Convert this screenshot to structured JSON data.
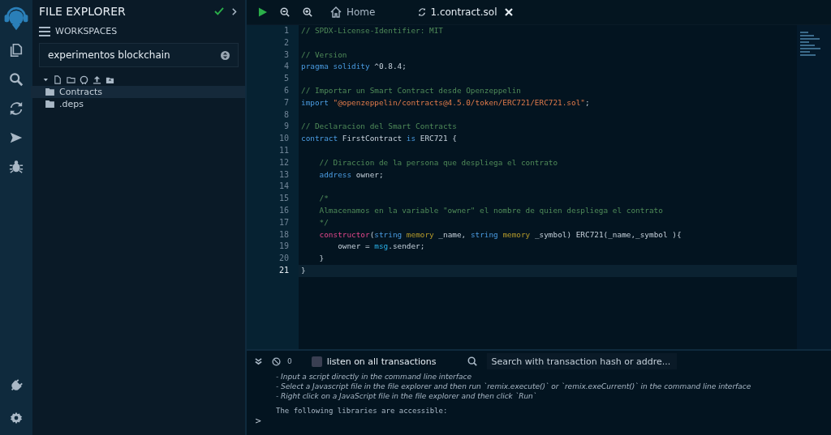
{
  "icon_bar": {
    "items": [
      {
        "kind": "files"
      },
      {
        "kind": "search"
      },
      {
        "kind": "compiler"
      },
      {
        "kind": "deploy"
      },
      {
        "kind": "debug"
      }
    ],
    "bottom": [
      {
        "kind": "plugin"
      },
      {
        "kind": "settings"
      }
    ]
  },
  "side_panel": {
    "title": "FILE EXPLORER",
    "workspaces_label": "WORKSPACES",
    "workspace": "experimentos blockchain",
    "tree": [
      {
        "label": "Contracts",
        "selected": true
      },
      {
        "label": ".deps",
        "selected": false
      }
    ]
  },
  "editor": {
    "tabs": [
      {
        "label": "Home",
        "kind": "home",
        "selected": false
      },
      {
        "label": "1.contract.sol",
        "kind": "file",
        "selected": true
      }
    ],
    "lines": [
      {
        "number": "1",
        "current": false,
        "tokens": [
          {
            "kind": "comment",
            "text": "// SPDX-License-Identifier: MIT"
          }
        ]
      },
      {
        "number": "2",
        "current": false
      },
      {
        "number": "3",
        "current": false,
        "tokens": [
          {
            "kind": "comment",
            "text": "// Version"
          }
        ]
      },
      {
        "number": "4",
        "current": false,
        "tokens": [
          {
            "kind": "keyword",
            "text": "pragma solidity"
          },
          {
            "kind": "plain",
            "text": " ^0.8.4;"
          }
        ]
      },
      {
        "number": "5",
        "current": false
      },
      {
        "number": "6",
        "current": false,
        "tokens": [
          {
            "kind": "comment",
            "text": "// Importar un Smart Contract desde Openzeppelin"
          }
        ]
      },
      {
        "number": "7",
        "current": false,
        "tokens": [
          {
            "kind": "keyword",
            "text": "import "
          },
          {
            "kind": "string",
            "text": "\"@openzeppelin/contracts@4.5.0/token/ERC721/ERC721.sol\""
          },
          {
            "kind": "plain",
            "text": ";"
          }
        ]
      },
      {
        "number": "8",
        "current": false
      },
      {
        "number": "9",
        "current": false,
        "tokens": [
          {
            "kind": "comment",
            "text": "// Declaracion del Smart Contracts"
          }
        ]
      },
      {
        "number": "10",
        "current": false,
        "tokens": [
          {
            "kind": "keyword",
            "text": "contract"
          },
          {
            "kind": "plain",
            "text": " FirstContract "
          },
          {
            "kind": "keyword",
            "text": "is"
          },
          {
            "kind": "plain",
            "text": " ERC721 {"
          }
        ]
      },
      {
        "number": "11",
        "current": false
      },
      {
        "number": "12",
        "current": false,
        "tokens": [
          {
            "kind": "comment",
            "text": "    // Diraccion de la persona que despliega el contrato"
          }
        ]
      },
      {
        "number": "13",
        "current": false,
        "tokens": [
          {
            "kind": "keyword",
            "text": "    address"
          },
          {
            "kind": "plain",
            "text": " owner;"
          }
        ]
      },
      {
        "number": "14",
        "current": false
      },
      {
        "number": "15",
        "current": false,
        "tokens": [
          {
            "kind": "comment",
            "text": "    /*"
          }
        ]
      },
      {
        "number": "16",
        "current": false,
        "tokens": [
          {
            "kind": "comment",
            "text": "    Almacenamos en la variable \"owner\" el nombre de quien despliega el contrato"
          }
        ]
      },
      {
        "number": "17",
        "current": false,
        "tokens": [
          {
            "kind": "comment",
            "text": "    */"
          }
        ]
      },
      {
        "number": "18",
        "current": false,
        "tokens": [
          {
            "kind": "special",
            "text": "    constructor"
          },
          {
            "kind": "plain",
            "text": "("
          },
          {
            "kind": "keyword",
            "text": "string "
          },
          {
            "kind": "storage",
            "text": "memory"
          },
          {
            "kind": "plain",
            "text": " _name, "
          },
          {
            "kind": "keyword",
            "text": "string "
          },
          {
            "kind": "storage",
            "text": "memory"
          },
          {
            "kind": "plain",
            "text": " _symbol) ERC721(_name,_symbol ){"
          }
        ]
      },
      {
        "number": "19",
        "current": false,
        "tokens": [
          {
            "kind": "plain",
            "text": "        owner = "
          },
          {
            "kind": "builtin",
            "text": "msg"
          },
          {
            "kind": "plain",
            "text": ".sender;"
          }
        ]
      },
      {
        "number": "20",
        "current": false,
        "tokens": [
          {
            "kind": "plain",
            "text": "    }"
          }
        ]
      },
      {
        "number": "21",
        "current": true,
        "tokens": [
          {
            "kind": "plain",
            "text": "}"
          }
        ]
      }
    ]
  },
  "terminal": {
    "count": "0",
    "listen_label": "listen on all transactions",
    "listen_checked": false,
    "search_placeholder": "Search with transaction hash or addre...",
    "output": [
      {
        "kind": "note",
        "text": "- Input a script directly in the command line interface"
      },
      {
        "kind": "note",
        "text": "- Select a Javascript file in the file explorer and then run `remix.execute()` or `remix.exeCurrent()`  in the command line interface"
      },
      {
        "kind": "note",
        "text": "- Right click on a JavaScript file in the file explorer and then click `Run`"
      },
      {
        "kind": "mono",
        "text": "The following libraries are accessible:"
      }
    ],
    "prompt": ">"
  }
}
